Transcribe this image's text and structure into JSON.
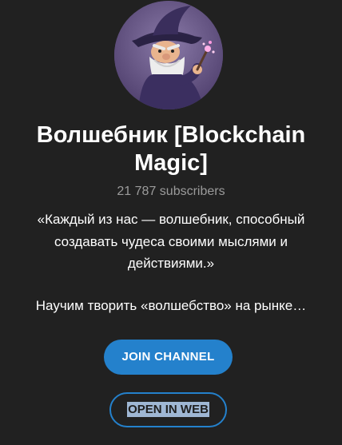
{
  "channel": {
    "title": "Волшебник [Blockchain Magic]",
    "subscribers": "21 787 subscribers",
    "description_quote": "«Каждый из нас — волшебник, способный создавать чудеса своими мыслями и действиями.»",
    "description_line": "Научим творить «волшебство» на рынке…",
    "avatar_icon": "wizard-avatar"
  },
  "actions": {
    "join_label": "JOIN CHANNEL",
    "web_label": "OPEN IN WEB"
  },
  "colors": {
    "background": "#212121",
    "accent": "#2481cc",
    "muted_text": "#9b9b9b"
  }
}
